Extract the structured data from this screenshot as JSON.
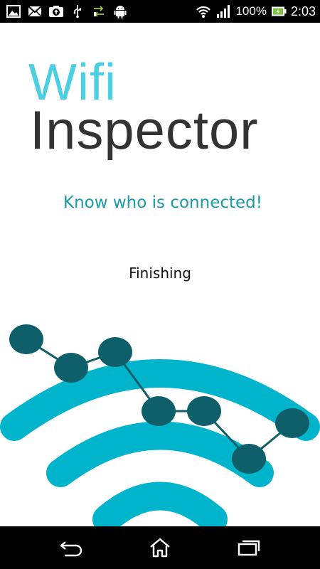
{
  "status_bar": {
    "left_icons": [
      "image-icon",
      "mail-icon",
      "camera-upload-icon",
      "usb-icon",
      "data-transfer-icon",
      "android-icon"
    ],
    "battery_percent": "100%",
    "time": "2:03"
  },
  "app": {
    "title_line1": "Wifi",
    "title_line2": "Inspector",
    "tagline": "Know who is connected!",
    "status": "Finishing"
  },
  "colors": {
    "accent": "#4ccee3",
    "tagline": "#1a9aa8",
    "wifi_arc": "#00b4cc",
    "node": "#0e5f6a",
    "title_dark": "#333333"
  },
  "nav_bar": {
    "icons": [
      "back-icon",
      "home-icon",
      "recent-apps-icon"
    ]
  }
}
